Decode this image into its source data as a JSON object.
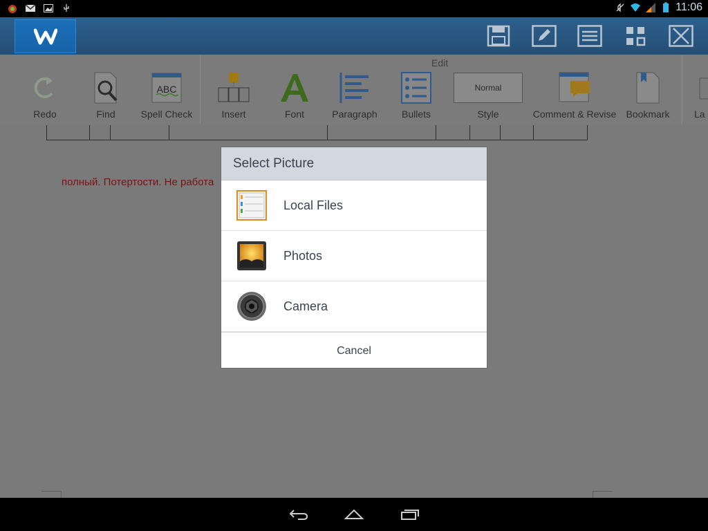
{
  "status_bar": {
    "time": "11:06",
    "left_icons": [
      "android-debug-icon",
      "gmail-icon",
      "gallery-icon",
      "usb-icon"
    ],
    "right_icons": [
      "mute-icon",
      "wifi-icon",
      "signal-icon",
      "battery-icon"
    ]
  },
  "title_bar": {
    "logo_letter": "W",
    "buttons": [
      "save-icon",
      "edit-icon",
      "list-icon",
      "grid-icon",
      "close-icon"
    ]
  },
  "ribbon": {
    "section_label": "Edit",
    "items": [
      {
        "label": "Redo",
        "icon": "redo-icon"
      },
      {
        "label": "Find",
        "icon": "find-icon"
      },
      {
        "label": "Spell Check",
        "icon": "spell-check-icon"
      },
      {
        "label": "Insert",
        "icon": "insert-icon"
      },
      {
        "label": "Font",
        "icon": "font-icon"
      },
      {
        "label": "Paragraph",
        "icon": "paragraph-icon"
      },
      {
        "label": "Bullets",
        "icon": "bullets-icon"
      },
      {
        "label": "Style",
        "icon": "style-icon",
        "style_preview": "Normal"
      },
      {
        "label": "Comment & Revise",
        "icon": "comment-icon"
      },
      {
        "label": "Bookmark",
        "icon": "bookmark-icon"
      },
      {
        "label": "La",
        "icon": "layout-icon"
      }
    ],
    "spell_check_text": "ABC"
  },
  "document": {
    "text": "полный. Потертости. Не работа"
  },
  "dialog": {
    "title": "Select Picture",
    "options": [
      {
        "label": "Local Files",
        "icon": "local-files-icon"
      },
      {
        "label": "Photos",
        "icon": "photos-icon"
      },
      {
        "label": "Camera",
        "icon": "camera-icon"
      }
    ],
    "cancel_label": "Cancel"
  },
  "nav_bar": {
    "buttons": [
      "back-icon",
      "home-icon",
      "recent-apps-icon"
    ]
  },
  "colors": {
    "title_bar": "#2d5f8c",
    "document_text": "#7a1212",
    "dialog_header": "#d2d7e0"
  }
}
